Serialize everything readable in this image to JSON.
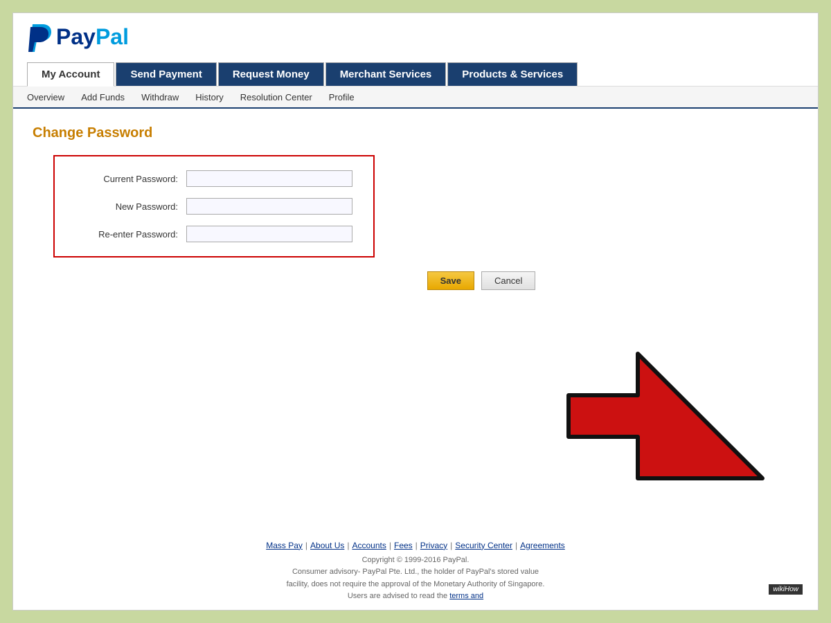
{
  "logo": {
    "pay": "Pay",
    "pal": "Pal"
  },
  "nav": {
    "tabs": [
      {
        "label": "My Account",
        "active": true
      },
      {
        "label": "Send Payment",
        "active": false
      },
      {
        "label": "Request Money",
        "active": false
      },
      {
        "label": "Merchant Services",
        "active": false
      },
      {
        "label": "Products & Services",
        "active": false
      }
    ],
    "subnav": [
      {
        "label": "Overview"
      },
      {
        "label": "Add Funds"
      },
      {
        "label": "Withdraw"
      },
      {
        "label": "History"
      },
      {
        "label": "Resolution Center"
      },
      {
        "label": "Profile"
      }
    ]
  },
  "page": {
    "title": "Change Password",
    "form": {
      "current_password_label": "Current Password:",
      "new_password_label": "New Password:",
      "reenter_password_label": "Re-enter Password:",
      "save_button": "Save",
      "cancel_button": "Cancel"
    }
  },
  "footer": {
    "links": [
      {
        "label": "Mass Pay"
      },
      {
        "label": "About Us"
      },
      {
        "label": "Accounts"
      },
      {
        "label": "Fees"
      },
      {
        "label": "Privacy"
      },
      {
        "label": "Security Center"
      },
      {
        "label": "Agreements"
      }
    ],
    "copyright": "Copyright © 1999-2016 PayPal.",
    "advisory": "Consumer advisory- PayPal Pte. Ltd., the holder of PayPal's stored value",
    "advisory2": "facility, does not require the approval of the Monetary Authority of Singapore.",
    "advisory3": "Users are advised to read the",
    "terms_link": "terms and",
    "wikihow": "wikiHow"
  }
}
